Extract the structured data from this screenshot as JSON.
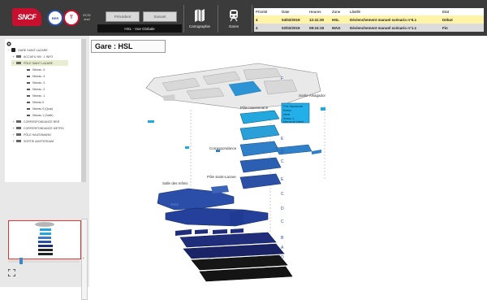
{
  "header": {
    "logo": "SNCF",
    "rer_badge": "RER",
    "t_badge": "T",
    "system_label": "ECSI",
    "system_sublabel": "sncf",
    "prev_label": "Précédent",
    "next_label": "Suivant",
    "view_label": "HSL - Vue Globale",
    "tools": [
      {
        "label": "Cartographie",
        "icon": "map-icon"
      },
      {
        "label": "Gares",
        "icon": "train-icon"
      }
    ]
  },
  "alerts": {
    "columns": [
      "Priorité",
      "Date",
      "Heures",
      "Zone",
      "Libellé",
      "Etat"
    ],
    "rows": [
      {
        "priority": "4",
        "date": "04/02/2019",
        "time": "12:41:30",
        "zone": "HSL",
        "label": "Déclenchement manuel scénario n°6.1",
        "state": "Début",
        "color": "#fff3a8"
      },
      {
        "priority": "4",
        "date": "02/02/2019",
        "time": "08:24:18",
        "zone": "MAG",
        "label": "Déclenchement manuel scénario n°1.1",
        "state": "Fin",
        "color": "#dcdcdc"
      }
    ]
  },
  "tree": {
    "items": [
      {
        "label": "GARE SAINT-LAZARE",
        "level": 1
      },
      {
        "label": "ACCUEIL NIV -1 INFO",
        "level": 2
      },
      {
        "label": "PÔLE SAINT LAZARE",
        "level": 2
      },
      {
        "label": "Niveau -5",
        "level": 3
      },
      {
        "label": "Niveau -4",
        "level": 3
      },
      {
        "label": "Niveau -3",
        "level": 3
      },
      {
        "label": "Niveau -2",
        "level": 3
      },
      {
        "label": "Niveau -1",
        "level": 3
      },
      {
        "label": "Niveau 0",
        "level": 3
      },
      {
        "label": "Niveau 0 (Quai)",
        "level": 3
      },
      {
        "label": "Niveau 1 (Salle)",
        "level": 3
      },
      {
        "label": "CORRESPONDANCE RER",
        "level": 2
      },
      {
        "label": "CORRESPONDANCE METRO",
        "level": 2
      },
      {
        "label": "PÔLE HAUSSMANN",
        "level": 2
      },
      {
        "label": "SORTIE AMSTERDAM",
        "level": 2
      }
    ]
  },
  "main": {
    "title": "Gare :  HSL",
    "labels": {
      "pole_haussmann": "Pôle Haussmann",
      "sortie_alsagadiya": "Sortie Alsagador",
      "correspondance": "Correspondance",
      "pole_saint_lazare": "Pôle Saint-Lazare",
      "salle_des_infinis": "Salle des Infinis"
    },
    "info_box": [
      "Pôle Haussmann",
      "Niveau",
      "Alerte",
      "Niveau -1",
      "Mesure de l'alerte"
    ],
    "level_letters": [
      "F",
      "F",
      "E",
      "D",
      "C",
      "E",
      "C",
      "D",
      "C",
      "B",
      "A",
      "D"
    ]
  },
  "colors": {
    "topbar": "#3b3b3b",
    "alert_yellow": "#fff3a8",
    "accent_cyan": "#22a8df",
    "navy": "#1f2d7a",
    "sncf_red": "#c8102e"
  }
}
